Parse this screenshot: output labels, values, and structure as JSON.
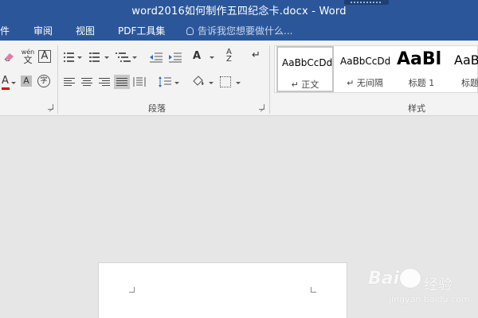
{
  "window": {
    "title": "word2016如何制作五四纪念卡.docx - Word"
  },
  "menu": {
    "tabs": [
      "件",
      "审阅",
      "视图",
      "PDF工具集"
    ],
    "tell_me": "告诉我您想要做什么..."
  },
  "ribbon": {
    "font_glyphs": {
      "pinyin_top": "wén",
      "pinyin_bottom": "文",
      "char_border": "A",
      "shade_a": "A",
      "enclose": "字",
      "font_color": "A"
    },
    "paragraph_glyphs": {
      "asian_layout": "A",
      "sort": "A",
      "sort_sub": "Z"
    },
    "groups": {
      "paragraph": "段落",
      "styles": "样式"
    },
    "styles": [
      {
        "sample": "AaBbCcDd",
        "name": "↵ 正文",
        "selected": true
      },
      {
        "sample": "AaBbCcDd",
        "name": "↵ 无间隔",
        "selected": false
      },
      {
        "sample": "AaBl",
        "name": "标题 1",
        "selected": false
      },
      {
        "sample": "AaBb",
        "name": "标题",
        "selected": false
      }
    ]
  },
  "watermark": {
    "brand": "Bai",
    "brand_cn": "经验",
    "url": "jingyan.baidu.com"
  },
  "colors": {
    "title_bar": "#2b579a",
    "ribbon_bg": "#f3f3f3",
    "canvas_bg": "#e6e6e6",
    "font_color_red": "#e00000"
  }
}
